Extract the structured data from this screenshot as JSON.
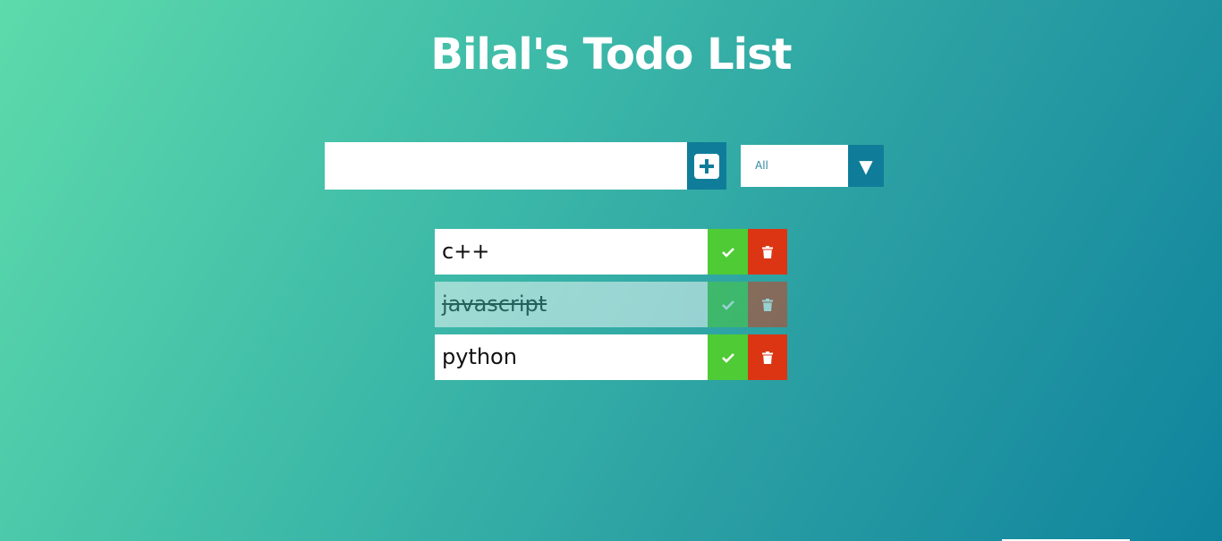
{
  "header": {
    "title": "Bilal's Todo List"
  },
  "form": {
    "input_value": "",
    "input_placeholder": "",
    "add_icon": "plus-square-icon"
  },
  "filter": {
    "selected": "All",
    "arrow_icon": "caret-down-icon"
  },
  "todos": [
    {
      "text": "c++",
      "completed": false
    },
    {
      "text": "javascript",
      "completed": true
    },
    {
      "text": "python",
      "completed": false
    }
  ],
  "colors": {
    "accent": "#0f7d99",
    "complete": "#4fcb35",
    "delete": "#dc3514",
    "gradient_start": "#5ddbab",
    "gradient_end": "#0f839d"
  }
}
